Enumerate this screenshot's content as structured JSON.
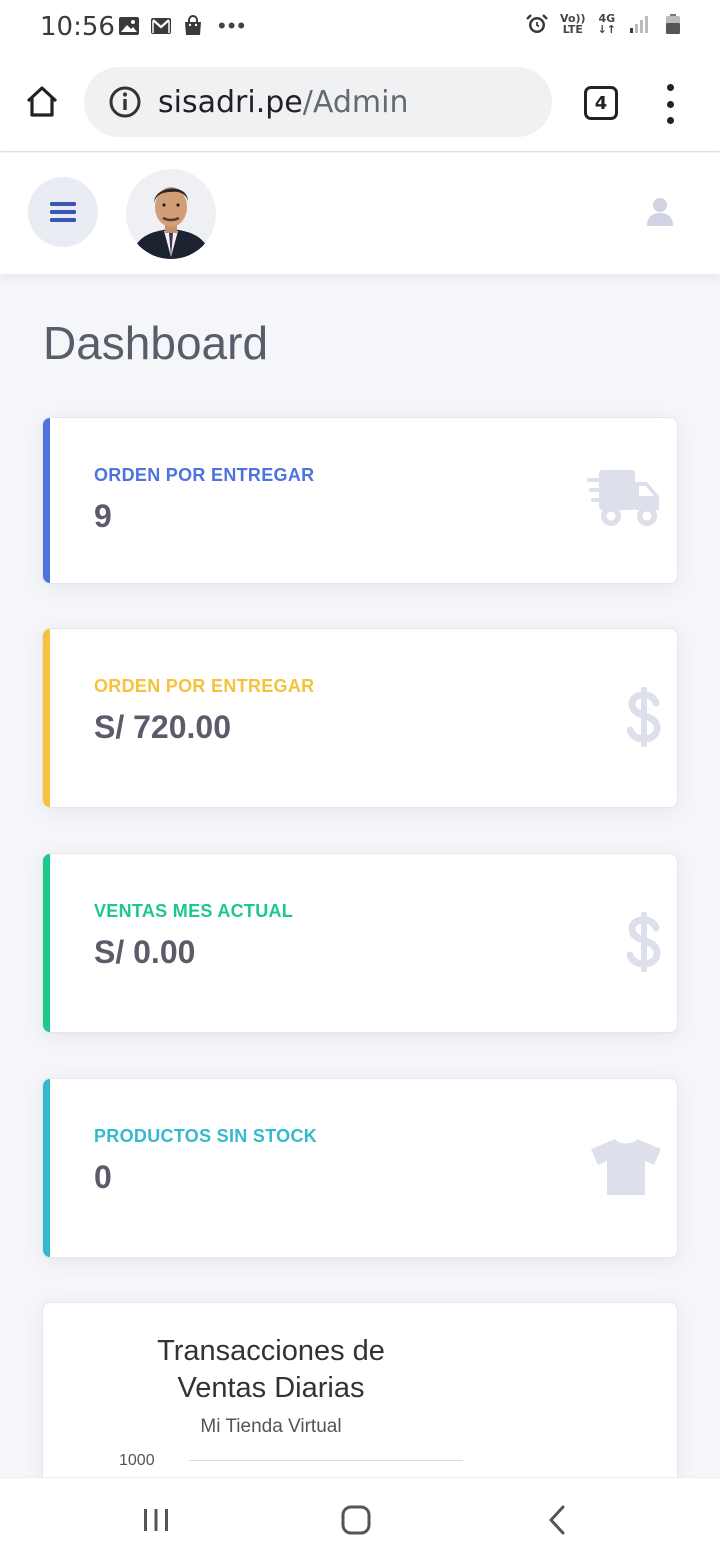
{
  "status_bar": {
    "time": "10:56",
    "more": "•••",
    "volte_top": "Vo))",
    "volte_bottom": "LTE",
    "network_top": "4G",
    "network_bottom": "↓↑",
    "icons_left": [
      "image-icon",
      "gmail-icon",
      "shopping-bag-icon"
    ],
    "icons_right": [
      "alarm-icon",
      "volte-indicator",
      "network-4g-indicator",
      "signal-icon",
      "battery-icon"
    ]
  },
  "browser": {
    "url_domain": "sisadri.pe",
    "url_path": "/Admin",
    "tab_count": "4"
  },
  "topbar": {
    "menu_icon": "hamburger-icon",
    "avatar": "profile-photo",
    "user_icon": "user-icon"
  },
  "page": {
    "title": "Dashboard"
  },
  "cards": [
    {
      "label": "ORDEN POR ENTREGAR",
      "value": "9",
      "color": "#4e73df",
      "icon": "truck-icon"
    },
    {
      "label": "ORDEN POR ENTREGAR",
      "value": "S/ 720.00",
      "color": "#f6c23e",
      "icon": "dollar-icon"
    },
    {
      "label": "VENTAS MES ACTUAL",
      "value": "S/ 0.00",
      "color": "#1cc88a",
      "icon": "dollar-icon"
    },
    {
      "label": "PRODUCTOS SIN STOCK",
      "value": "0",
      "color": "#36b9cc",
      "icon": "tshirt-icon"
    }
  ],
  "chart": {
    "title_line1": "Transacciones de",
    "title_line2": "Ventas Diarias",
    "subtitle": "Mi Tienda Virtual",
    "y_tick_top": "1000"
  },
  "nav_bar": {
    "buttons": [
      "recents-icon",
      "home-icon",
      "back-icon"
    ]
  },
  "colors": {
    "primary": "#4e73df",
    "warning": "#f6c23e",
    "success": "#1cc88a",
    "info": "#36b9cc",
    "icon_muted": "#dddfeb"
  }
}
